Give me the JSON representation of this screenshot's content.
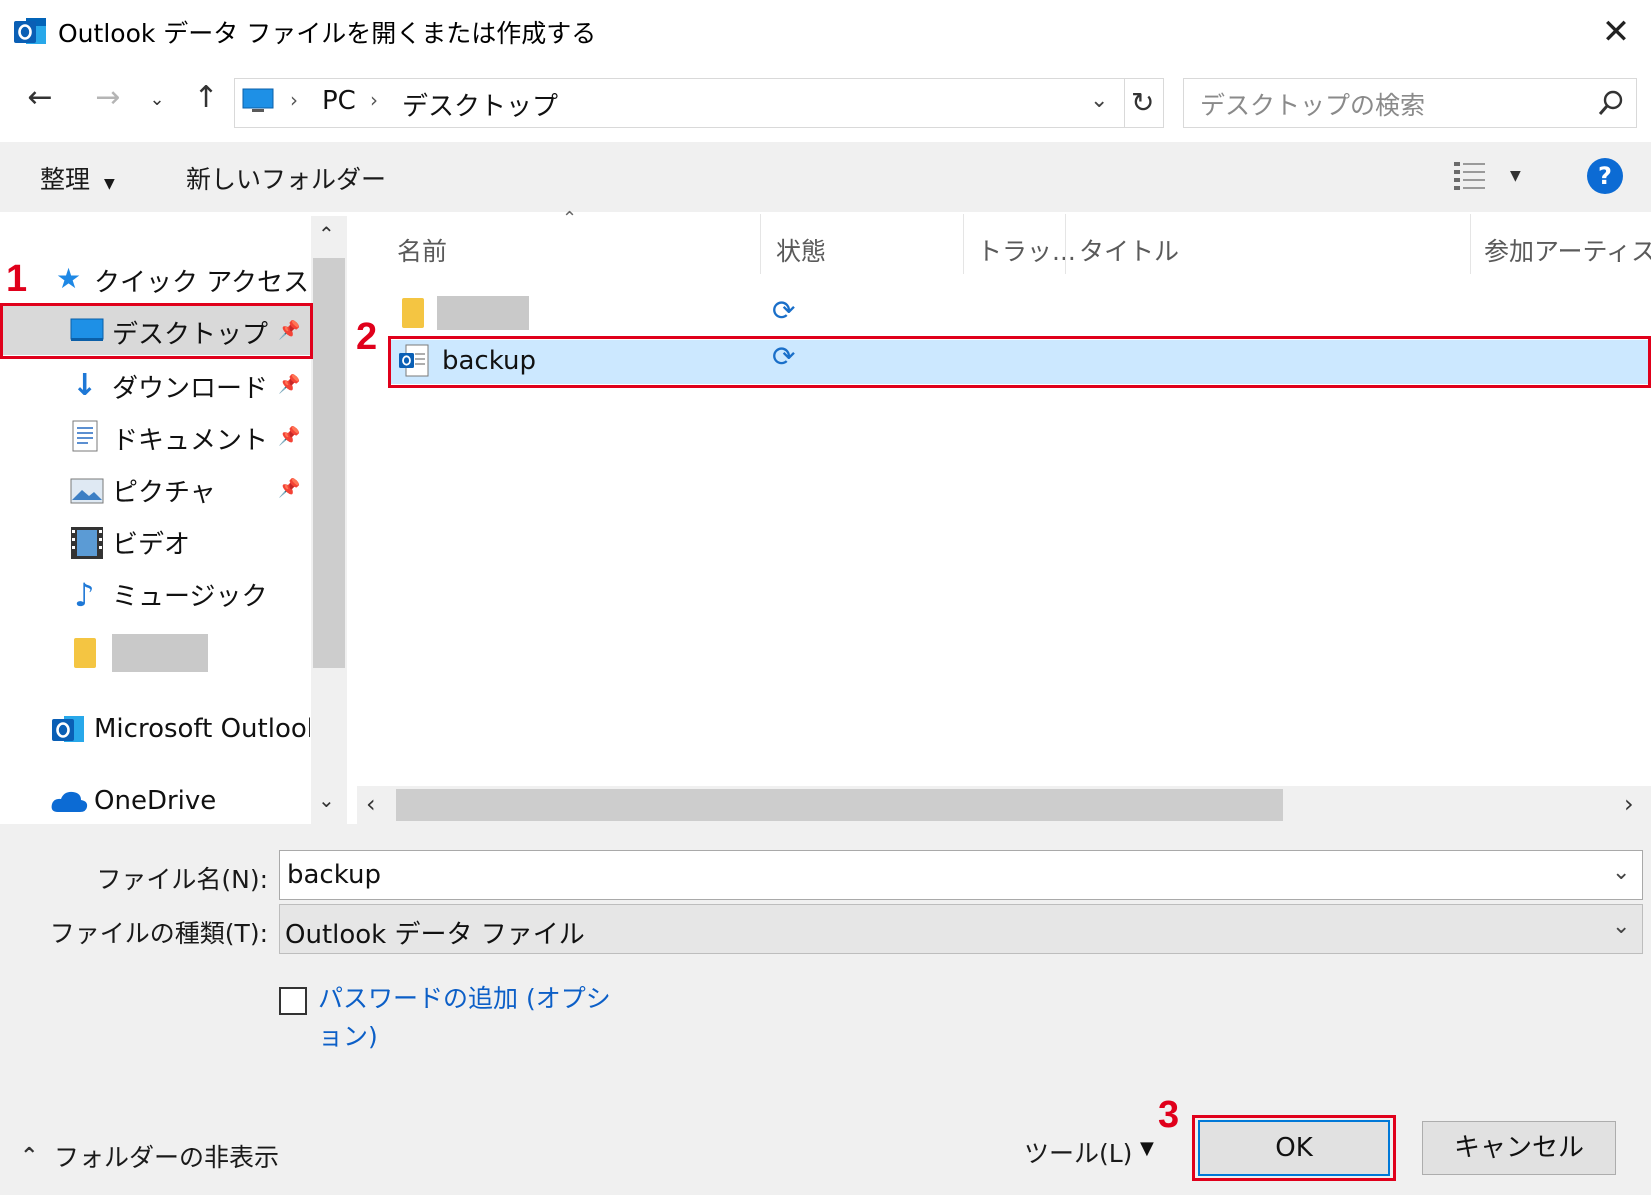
{
  "window": {
    "title": "Outlook データ ファイルを開くまたは作成する"
  },
  "address": {
    "breadcrumb": [
      "PC",
      "デスクトップ"
    ],
    "search_placeholder": "デスクトップの検索"
  },
  "toolbar": {
    "organize": "整理",
    "new_folder": "新しいフォルダー"
  },
  "nav": {
    "quick_access": "クイック アクセス",
    "items": [
      {
        "label": "デスクトップ",
        "icon": "desktop-icon",
        "pinned": true
      },
      {
        "label": "ダウンロード",
        "icon": "download-icon",
        "pinned": true
      },
      {
        "label": "ドキュメント",
        "icon": "document-icon",
        "pinned": true
      },
      {
        "label": "ピクチャ",
        "icon": "picture-icon",
        "pinned": true
      },
      {
        "label": "ビデオ",
        "icon": "video-icon",
        "pinned": false
      },
      {
        "label": "ミュージック",
        "icon": "music-icon",
        "pinned": false
      }
    ],
    "outlook": "Microsoft Outlook",
    "onedrive": "OneDrive"
  },
  "columns": {
    "name": "名前",
    "status": "状態",
    "track": "トラッ...",
    "title": "タイトル",
    "artist": "参加アーティスト"
  },
  "files": [
    {
      "name": "",
      "type": "folder",
      "redacted": true
    },
    {
      "name": "backup",
      "type": "outlook-data-file",
      "selected": true
    }
  ],
  "bottom": {
    "filename_label": "ファイル名(N):",
    "filename_value": "backup",
    "filetype_label": "ファイルの種類(T):",
    "filetype_value": "Outlook データ ファイル",
    "password_line1": "パスワードの追加 (オプシ",
    "password_line2": "ョン)",
    "hide_folders": "フォルダーの非表示",
    "tools": "ツール(L)",
    "ok": "OK",
    "cancel": "キャンセル"
  },
  "annotations": {
    "step1": "1",
    "step2": "2",
    "step3": "3"
  },
  "colors": {
    "accent": "#0078d7",
    "selection": "#cce8ff",
    "annotation_red": "#e0001b"
  }
}
